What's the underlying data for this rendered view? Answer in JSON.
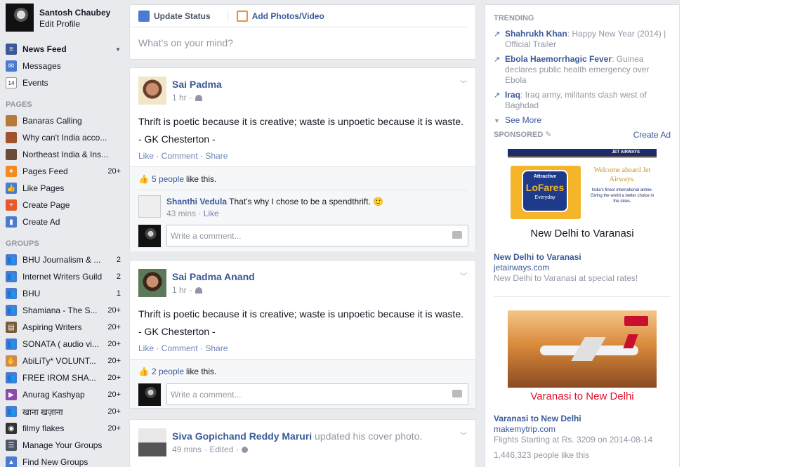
{
  "profile": {
    "name": "Santosh Chaubey",
    "edit": "Edit Profile"
  },
  "nav": [
    {
      "label": "News Feed",
      "icon": "news-feed-icon",
      "color": "#3b5998"
    },
    {
      "label": "Messages",
      "icon": "messages-icon",
      "color": "#4a7bd0"
    },
    {
      "label": "Events",
      "icon": "events-icon",
      "color": "#ffffff",
      "badge": "14"
    }
  ],
  "pages_header": "PAGES",
  "pages": [
    {
      "label": "Banaras Calling",
      "count": ""
    },
    {
      "label": "Why can't India acco...",
      "count": ""
    },
    {
      "label": "Northeast India & Ins...",
      "count": ""
    },
    {
      "label": "Pages Feed",
      "count": "20+"
    },
    {
      "label": "Like Pages",
      "count": ""
    },
    {
      "label": "Create Page",
      "count": ""
    },
    {
      "label": "Create Ad",
      "count": ""
    }
  ],
  "groups_header": "GROUPS",
  "groups": [
    {
      "label": "BHU Journalism & ...",
      "count": "2"
    },
    {
      "label": "Internet Writers Guild",
      "count": "2"
    },
    {
      "label": "BHU",
      "count": "1"
    },
    {
      "label": "Shamiana - The S...",
      "count": "20+"
    },
    {
      "label": "Aspiring Writers",
      "count": "20+"
    },
    {
      "label": "SONATA ( audio vi...",
      "count": "20+"
    },
    {
      "label": "AbiLiTy* VOLUNT...",
      "count": "20+"
    },
    {
      "label": "FREE IROM SHA...",
      "count": "20+"
    },
    {
      "label": "Anurag Kashyap",
      "count": "20+"
    },
    {
      "label": "खाना खज़ाना",
      "count": "20+"
    },
    {
      "label": "filmy flakes",
      "count": "20+"
    },
    {
      "label": "Manage Your Groups",
      "count": ""
    },
    {
      "label": "Find New Groups",
      "count": ""
    }
  ],
  "composer": {
    "update_status": "Update Status",
    "add_photos": "Add Photos/Video",
    "placeholder": "What's on your mind?"
  },
  "posts": [
    {
      "author": "Sai Padma",
      "time": "1 hr",
      "text1": "Thrift is poetic because it is creative; waste is unpoetic because it is waste.",
      "text2": "- GK Chesterton -",
      "actions": "Like · Comment · Share",
      "likes_count": "5 people",
      "likes_suffix": "like this.",
      "comment_author": "Shanthi Vedula",
      "comment_text": "That's why I chose to be a spendthrift. 🙂",
      "comment_time": "43 mins",
      "comment_like": "Like",
      "write_comment": "Write a comment..."
    },
    {
      "author": "Sai Padma Anand",
      "time": "1 hr",
      "text1": "Thrift is poetic because it is creative; waste is unpoetic because it is waste.",
      "text2": "- GK Chesterton -",
      "actions": "Like · Comment · Share",
      "likes_count": "2 people",
      "likes_suffix": "like this.",
      "write_comment": "Write a comment..."
    },
    {
      "author": "Siva Gopichand Reddy Maruri",
      "activity": "updated his cover photo.",
      "time": "49 mins",
      "edited": "· Edited ·"
    }
  ],
  "trending": {
    "header": "TRENDING",
    "items": [
      {
        "name": "Shahrukh Khan",
        "text": ": Happy New Year (2014) | Official Trailer"
      },
      {
        "name": "Ebola Haemorrhagic Fever",
        "text": ": Guinea declares public health emergency over Ebola"
      },
      {
        "name": "Iraq",
        "text": ": Iraq army, militants clash west of Baghdad"
      }
    ],
    "see_more": "See More"
  },
  "sponsored": {
    "header": "SPONSORED",
    "create_ad": "Create Ad",
    "ads": [
      {
        "banner_brand": "JET AIRWAYS",
        "banner_welcome": "Welcome aboard Jet Airways.",
        "banner_sub": "India's finest international airline. Giving the world a better choice in the skies.",
        "badge_top": "Attractive",
        "badge_main": "LoFares",
        "badge_bottom": "Everyday",
        "caption": "New Delhi to Varanasi",
        "title": "New Delhi to Varanasi",
        "domain": "jetairways.com",
        "desc": "New Delhi to Varanasi at special rates!"
      },
      {
        "caption": "Varanasi to New Delhi",
        "title": "Varanasi to New Delhi",
        "domain": "makemytrip.com",
        "desc": "Flights Starting at Rs. 3209 on 2014-08-14",
        "likes": "1,446,323 people like this"
      }
    ]
  }
}
